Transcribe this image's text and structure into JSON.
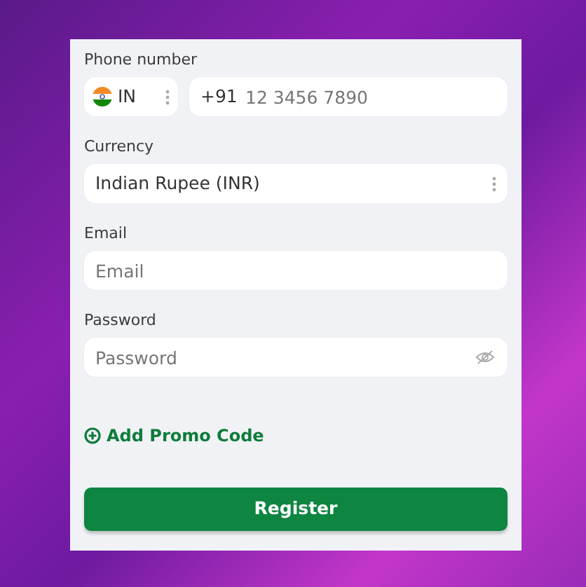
{
  "phone": {
    "label": "Phone number",
    "country_code": "IN",
    "prefix": "+91",
    "placeholder": "12 3456 7890"
  },
  "currency": {
    "label": "Currency",
    "value": "Indian Rupee (INR)"
  },
  "email": {
    "label": "Email",
    "placeholder": "Email"
  },
  "password": {
    "label": "Password",
    "placeholder": "Password"
  },
  "promo_link": "Add Promo Code",
  "submit_button": "Register"
}
